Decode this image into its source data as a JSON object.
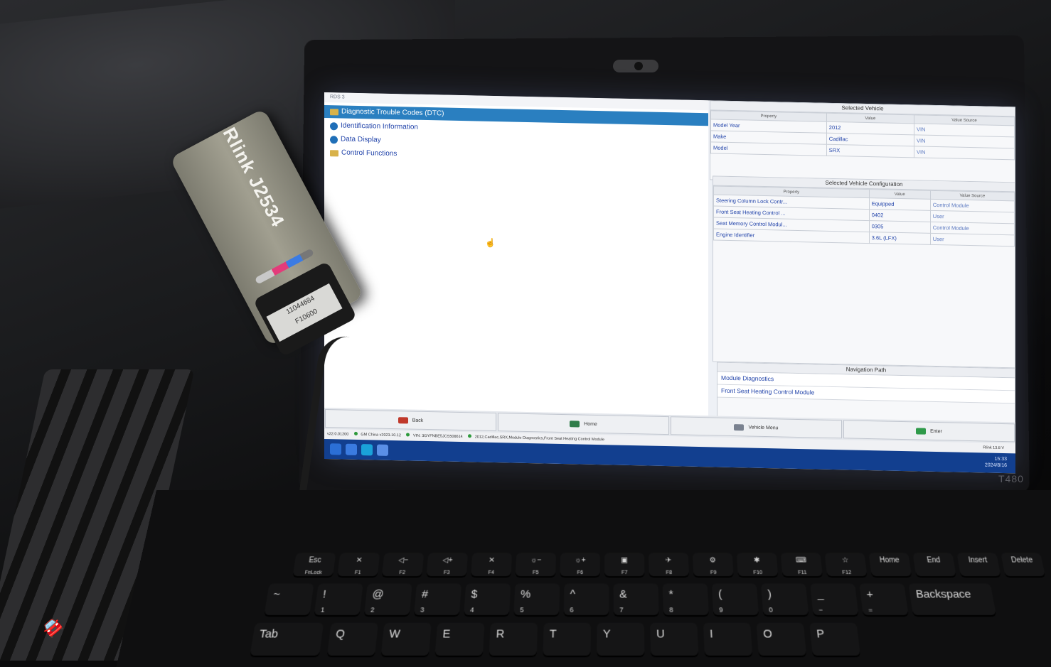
{
  "device": {
    "name": "Rlink J2534",
    "serial": "11044684",
    "model_code": "F10600"
  },
  "laptop": {
    "model": "T480"
  },
  "window": {
    "title": "RDS 3",
    "controls": "– □ ×"
  },
  "menu": {
    "items": [
      {
        "label": "Diagnostic Trouble Codes (DTC)",
        "icon": "folder-icon",
        "selected": true
      },
      {
        "label": "Identification Information",
        "icon": "info-circle-icon",
        "selected": false
      },
      {
        "label": "Data Display",
        "icon": "data-circle-icon",
        "selected": false
      },
      {
        "label": "Control Functions",
        "icon": "folder-icon",
        "selected": false
      }
    ]
  },
  "selected_vehicle": {
    "title": "Selected Vehicle",
    "headers": [
      "Property",
      "Value",
      "Value Source"
    ],
    "rows": [
      {
        "property": "Model Year",
        "value": "2012",
        "source": "VIN"
      },
      {
        "property": "Make",
        "value": "Cadillac",
        "source": "VIN"
      },
      {
        "property": "Model",
        "value": "SRX",
        "source": "VIN"
      }
    ]
  },
  "vehicle_config": {
    "title": "Selected Vehicle Configuration",
    "headers": [
      "Property",
      "Value",
      "Value Source"
    ],
    "rows": [
      {
        "property": "Steering Column Lock Contr...",
        "value": "Equipped",
        "source": "Control Module"
      },
      {
        "property": "Front Seat Heating Control ...",
        "value": "0402",
        "source": "User"
      },
      {
        "property": "Seat Memory Control Modul...",
        "value": "0305",
        "source": "Control Module"
      },
      {
        "property": "Engine Identifier",
        "value": "3.6L (LFX)",
        "source": "User"
      }
    ]
  },
  "navigation_path": {
    "title": "Navigation Path",
    "items": [
      "Module Diagnostics",
      "Front Seat Heating Control Module"
    ]
  },
  "buttons": {
    "back": "Back",
    "home": "Home",
    "vehicle_menu": "Vehicle Menu",
    "enter": "Enter"
  },
  "status_bar": {
    "version": "v22.0.01200",
    "database": "GM China v2023.10.12",
    "vin": "VIN: 3GYFNBE5JCS508614",
    "path": "2012,Cadillac,SRX,Module Diagnostics,Front Seat Heating Control Module",
    "right": "Rlink  13.8 V"
  },
  "taskbar": {
    "time": "15:33",
    "date": "2024/8/16"
  },
  "keyboard": {
    "fn_row": [
      {
        "top": "Esc",
        "sub": "FnLock"
      },
      {
        "top": "✕",
        "sub": "F1"
      },
      {
        "top": "◁−",
        "sub": "F2"
      },
      {
        "top": "◁+",
        "sub": "F3"
      },
      {
        "top": "✕",
        "sub": "F4"
      },
      {
        "top": "☼−",
        "sub": "F5"
      },
      {
        "top": "☼+",
        "sub": "F6"
      },
      {
        "top": "▣",
        "sub": "F7"
      },
      {
        "top": "✈",
        "sub": "F8"
      },
      {
        "top": "⚙",
        "sub": "F9"
      },
      {
        "top": "✱",
        "sub": "F10"
      },
      {
        "top": "⌨",
        "sub": "F11"
      },
      {
        "top": "☆",
        "sub": "F12"
      },
      {
        "top": "Home",
        "sub": ""
      },
      {
        "top": "End",
        "sub": ""
      },
      {
        "top": "Insert",
        "sub": ""
      },
      {
        "top": "Delete",
        "sub": ""
      }
    ],
    "num_row": [
      {
        "top": "~",
        "sub": ""
      },
      {
        "top": "!",
        "sub": "1"
      },
      {
        "top": "@",
        "sub": "2"
      },
      {
        "top": "#",
        "sub": "3"
      },
      {
        "top": "$",
        "sub": "4"
      },
      {
        "top": "%",
        "sub": "5"
      },
      {
        "top": "^",
        "sub": "6"
      },
      {
        "top": "&",
        "sub": "7"
      },
      {
        "top": "*",
        "sub": "8"
      },
      {
        "top": "(",
        "sub": "9"
      },
      {
        "top": ")",
        "sub": "0"
      },
      {
        "top": "_",
        "sub": "−"
      },
      {
        "top": "+",
        "sub": "="
      },
      {
        "top": "Backspace",
        "sub": ""
      }
    ],
    "letter_row": [
      "Tab",
      "Q",
      "W",
      "E",
      "R",
      "T",
      "Y",
      "U",
      "I",
      "O",
      "P"
    ]
  },
  "colors": {
    "selection": "#2a7fc0",
    "link_text": "#2244aa",
    "taskbar": "#123f8f",
    "status_ok": "#2e9a3c"
  }
}
